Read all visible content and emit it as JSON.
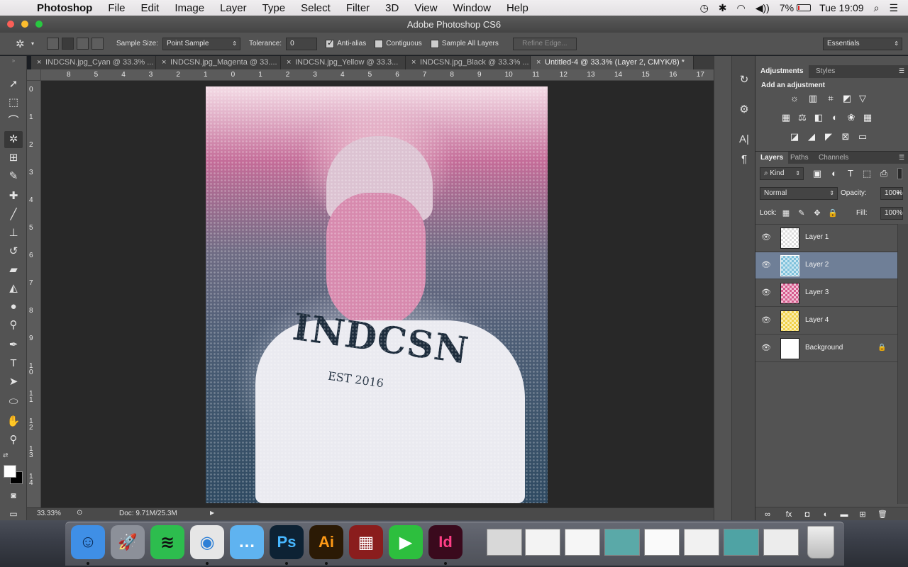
{
  "menubar": {
    "app": "Photoshop",
    "items": [
      "File",
      "Edit",
      "Image",
      "Layer",
      "Type",
      "Select",
      "Filter",
      "3D",
      "View",
      "Window",
      "Help"
    ],
    "battery": "7%",
    "clock": "Tue 19:09"
  },
  "window": {
    "title": "Adobe Photoshop CS6"
  },
  "options": {
    "sample_size_label": "Sample Size:",
    "sample_size_value": "Point Sample",
    "tolerance_label": "Tolerance:",
    "tolerance_value": "0",
    "antialias_label": "Anti-alias",
    "antialias_checked": true,
    "contiguous_label": "Contiguous",
    "contiguous_checked": false,
    "sample_all_label": "Sample All Layers",
    "sample_all_checked": false,
    "refine_edge_label": "Refine Edge...",
    "workspace_value": "Essentials"
  },
  "tabs": [
    {
      "label": "INDCSN.jpg_Cyan @ 33.3% ...",
      "active": false
    },
    {
      "label": "INDCSN.jpg_Magenta @ 33....",
      "active": false
    },
    {
      "label": "INDCSN.jpg_Yellow @ 33.3...",
      "active": false
    },
    {
      "label": "INDCSN.jpg_Black @ 33.3% ...",
      "active": false
    },
    {
      "label": "Untitled-4 @ 33.3% (Layer 2, CMYK/8) *",
      "active": true
    }
  ],
  "ruler": {
    "h_ticks": [
      "8",
      "5",
      "4",
      "3",
      "2",
      "1",
      "0",
      "1",
      "2",
      "3",
      "4",
      "5",
      "6",
      "7",
      "8",
      "9",
      "10",
      "11",
      "12",
      "13",
      "14",
      "15",
      "16",
      "17"
    ],
    "v_ticks": [
      "0",
      "1",
      "2",
      "3",
      "4",
      "5",
      "6",
      "7",
      "8",
      "9",
      "1\n0",
      "1\n1",
      "1\n2",
      "1\n3",
      "1\n4"
    ]
  },
  "canvas": {
    "shirt_text": "INDCSN",
    "shirt_subtext": "EST 2016"
  },
  "status": {
    "zoom": "33.33%",
    "doc_info": "Doc: 9.71M/25.3M"
  },
  "adjustments": {
    "tabs": [
      "Adjustments",
      "Styles"
    ],
    "heading": "Add an adjustment"
  },
  "layers_panel": {
    "tabs": [
      "Layers",
      "Paths",
      "Channels"
    ],
    "filter_kind": "Kind",
    "blend_mode": "Normal",
    "opacity_label": "Opacity:",
    "opacity_value": "100%",
    "lock_label": "Lock:",
    "fill_label": "Fill:",
    "fill_value": "100%",
    "layers": [
      {
        "name": "Layer 1",
        "selected": false,
        "color": "#e8e8e8"
      },
      {
        "name": "Layer 2",
        "selected": true,
        "color": "#4aa7c8"
      },
      {
        "name": "Layer 3",
        "selected": false,
        "color": "#d0487c"
      },
      {
        "name": "Layer 4",
        "selected": false,
        "color": "#f2d23c"
      },
      {
        "name": "Background",
        "selected": false,
        "color": "#ffffff",
        "locked": true
      }
    ]
  },
  "dock": {
    "apps": [
      {
        "name": "Finder",
        "glyph": "☺",
        "bg": "#3f8fe6",
        "fg": "#0a2a55"
      },
      {
        "name": "Launchpad",
        "glyph": "🚀",
        "bg": "#8c9099",
        "fg": "#222"
      },
      {
        "name": "Spotify",
        "glyph": "≋",
        "bg": "#2dbd4e",
        "fg": "#111"
      },
      {
        "name": "Chrome",
        "glyph": "◉",
        "bg": "#e6e6e6",
        "fg": "#2d7fd6"
      },
      {
        "name": "Messages",
        "glyph": "…",
        "bg": "#5fb3f0",
        "fg": "#fff"
      },
      {
        "name": "Photoshop",
        "glyph": "Ps",
        "bg": "#0d2234",
        "fg": "#47b7ff"
      },
      {
        "name": "Illustrator",
        "glyph": "Ai",
        "bg": "#2b1a05",
        "fg": "#ff9a16"
      },
      {
        "name": "Photo Booth",
        "glyph": "▦",
        "bg": "#8a1d1d",
        "fg": "#fff"
      },
      {
        "name": "FaceTime",
        "glyph": "▶",
        "bg": "#2dbf3e",
        "fg": "#fff"
      },
      {
        "name": "InDesign",
        "glyph": "Id",
        "bg": "#3a0a1d",
        "fg": "#ff3e86"
      }
    ]
  }
}
